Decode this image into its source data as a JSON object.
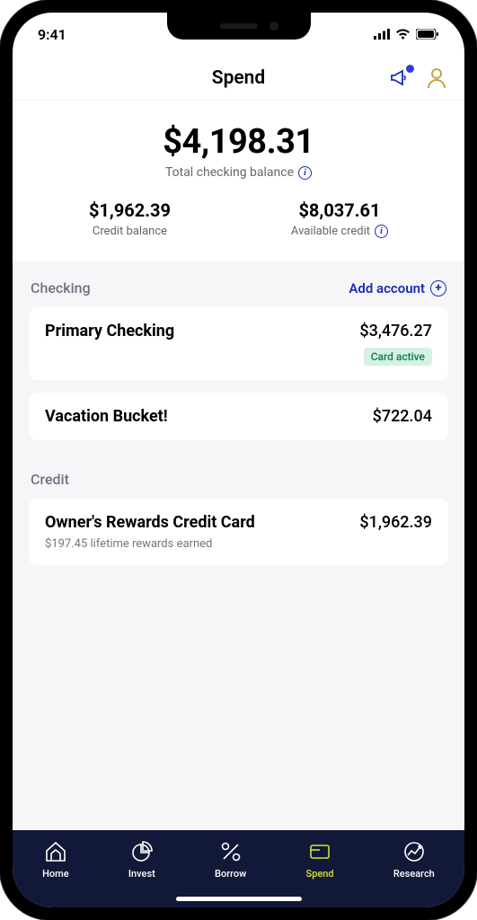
{
  "status": {
    "time": "9:41"
  },
  "header": {
    "title": "Spend"
  },
  "hero": {
    "big": "$4,198.31",
    "big_label": "Total checking balance",
    "left_val": "$1,962.39",
    "left_label": "Credit balance",
    "right_val": "$8,037.61",
    "right_label": "Available credit"
  },
  "sections": {
    "checking": {
      "title": "Checking",
      "add": "Add account"
    },
    "credit": {
      "title": "Credit"
    }
  },
  "accounts": {
    "0": {
      "name": "Primary Checking",
      "amount": "$3,476.27",
      "badge": "Card active"
    },
    "1": {
      "name": "Vacation Bucket!",
      "amount": "$722.04"
    },
    "2": {
      "name": "Owner's Rewards Credit Card",
      "amount": "$1,962.39",
      "sub": "$197.45 lifetime rewards earned"
    }
  },
  "nav": {
    "0": "Home",
    "1": "Invest",
    "2": "Borrow",
    "3": "Spend",
    "4": "Research"
  }
}
